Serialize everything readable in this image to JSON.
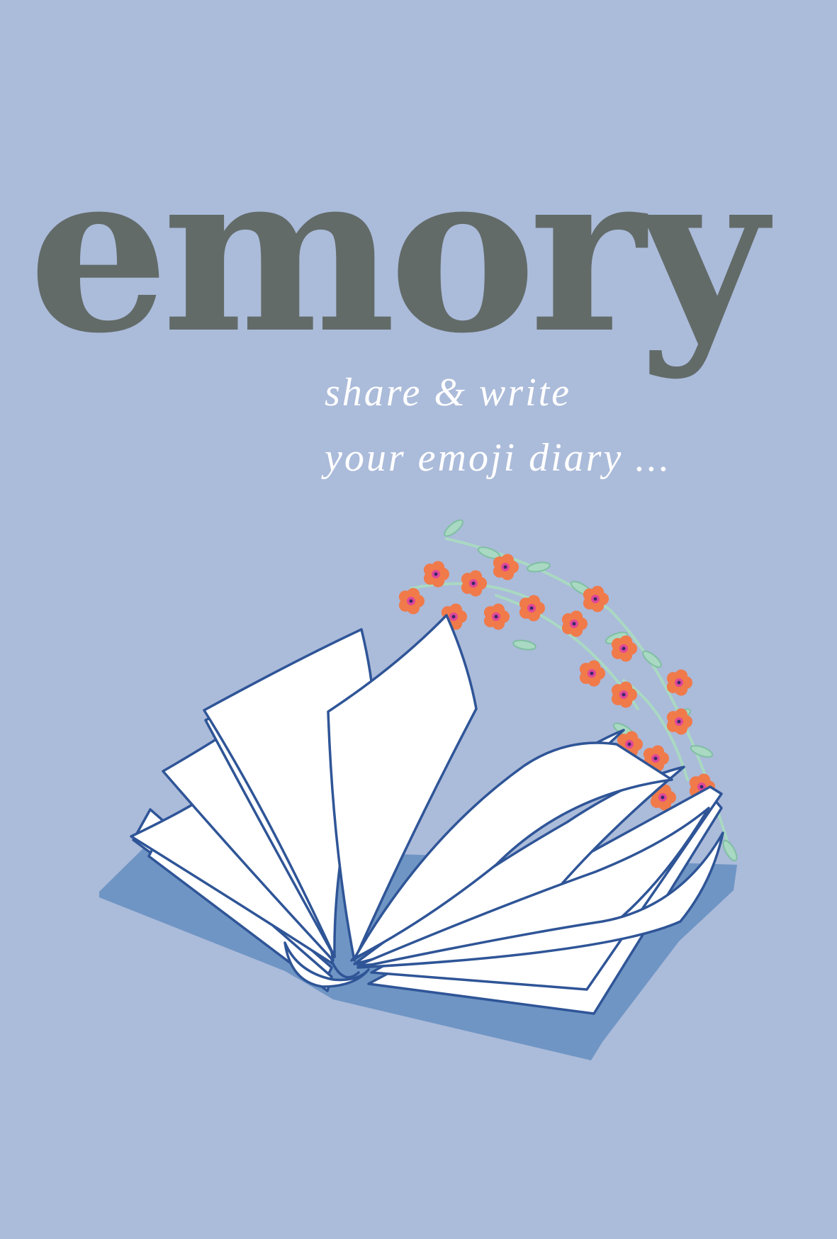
{
  "brand": {
    "title": "emory"
  },
  "tagline": {
    "line1": "share & write",
    "line2": "your emoji diary ..."
  },
  "colors": {
    "background": "#abbbda",
    "title": "#626b68",
    "tagline": "#ffffff",
    "book_shadow": "#6f95c4",
    "book_outline": "#2f5597",
    "page": "#ffffff",
    "flower_petal": "#f07a4a",
    "flower_center": "#e0479a",
    "leaf": "#a9d9c2"
  },
  "illustration": {
    "book_icon": "open-book-icon",
    "flower_icon": "flower-sprig-icon"
  }
}
